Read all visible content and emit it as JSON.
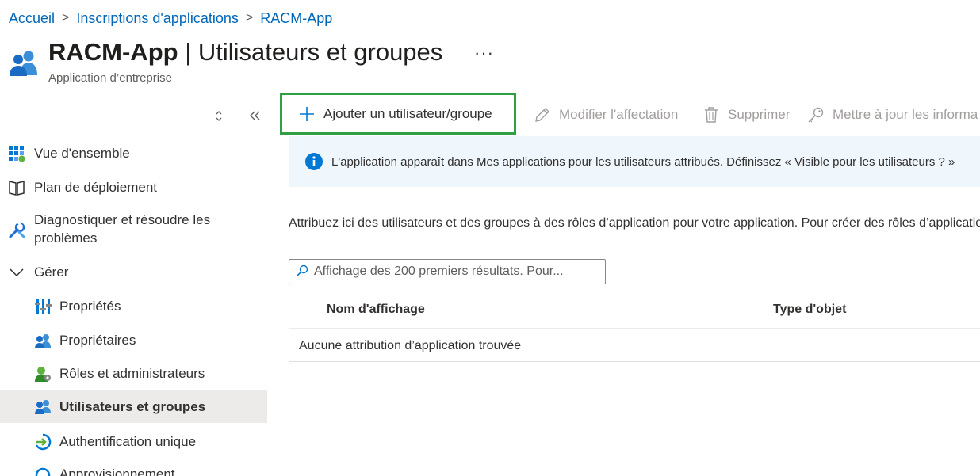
{
  "breadcrumb": {
    "items": [
      "Accueil",
      "Inscriptions d'applications",
      "RACM-App"
    ],
    "separator": ">"
  },
  "header": {
    "title_app": "RACM-App",
    "title_sep": " | ",
    "title_page": "Utilisateurs et groupes",
    "more": "···",
    "subtitle": "Application d’entreprise"
  },
  "sidebar": {
    "items": [
      {
        "label": "Vue d'ensemble",
        "icon": "grid-overview-icon"
      },
      {
        "label": "Plan de déploiement",
        "icon": "book-icon"
      },
      {
        "label": "Diagnostiquer et résoudre les",
        "label2": "problèmes",
        "icon": "wrench-icon"
      },
      {
        "label": "Gérer",
        "icon": "chevron-down-icon"
      },
      {
        "label": "Propriétés",
        "icon": "properties-icon"
      },
      {
        "label": "Propriétaires",
        "icon": "owners-icon"
      },
      {
        "label": "Rôles et administrateurs",
        "icon": "roles-icon"
      },
      {
        "label": "Utilisateurs et groupes",
        "icon": "users-groups-icon",
        "selected": true
      },
      {
        "label": "Authentification unique",
        "icon": "sso-icon"
      },
      {
        "label": "Approvisionnement",
        "icon": "provisioning-icon"
      }
    ]
  },
  "toolbar": {
    "add_label": "Ajouter un utilisateur/groupe",
    "edit_label": "Modifier l'affectation",
    "delete_label": "Supprimer",
    "update_label": "Mettre à jour les informa"
  },
  "info": {
    "text": "L'application apparaît dans Mes applications pour les utilisateurs attribués. Définissez « Visible pour les utilisateurs ? »"
  },
  "description": "Attribuez ici des utilisateurs et des groupes à des rôles d’application pour votre application. Pour créer des rôles d’application",
  "search": {
    "placeholder": "Affichage des 200 premiers résultats. Pour..."
  },
  "table": {
    "columns": [
      "Nom d'affichage",
      "Type d'objet"
    ],
    "empty_message": "Aucune attribution d’application trouvée"
  },
  "colors": {
    "link": "#0067b8",
    "highlight_border": "#2ea043",
    "info_bg": "#eff6fc",
    "info_icon": "#0078d4",
    "selected_bg": "#edebe9"
  }
}
